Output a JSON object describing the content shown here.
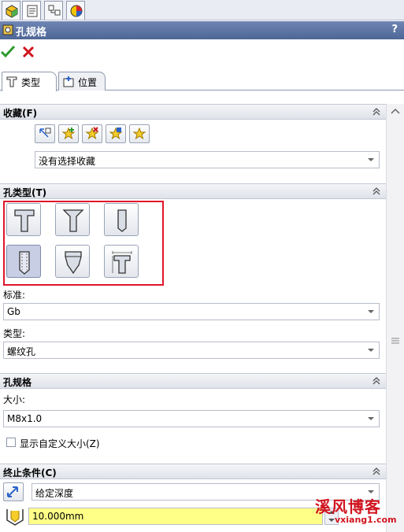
{
  "title_bar": {
    "title": "孔规格",
    "help": "?"
  },
  "sub_tabs": [
    {
      "label": "类型"
    },
    {
      "label": "位置"
    }
  ],
  "favorites": {
    "header": "收藏(F)",
    "selected": "没有选择收藏"
  },
  "hole_type": {
    "header": "孔类型(T)",
    "standard_label": "标准:",
    "standard_value": "Gb",
    "type_label": "类型:",
    "type_value": "螺纹孔"
  },
  "hole_spec": {
    "header": "孔规格",
    "size_label": "大小:",
    "size_value": "M8x1.0",
    "custom_size_label": "显示自定义大小(Z)"
  },
  "end_condition": {
    "header": "终止条件(C)",
    "condition_value": "给定深度",
    "depth_value": "10.000mm"
  },
  "watermark": {
    "text": "溪风博客",
    "url": "vxiang1.com"
  },
  "colors": {
    "title_bar": "#5a71a3",
    "highlight_box": "#e0162b",
    "depth_field": "#ffff88",
    "accept": "#2e9a2e",
    "cancel": "#d0141e"
  }
}
